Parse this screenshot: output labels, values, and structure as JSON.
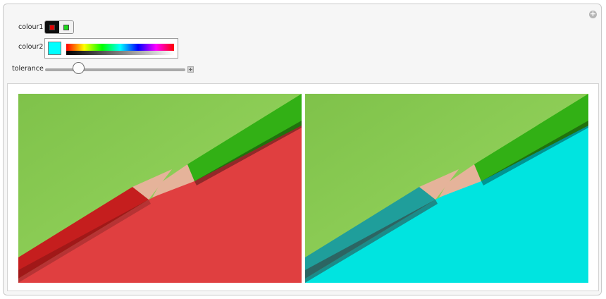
{
  "controls": {
    "colour1": {
      "label": "colour1",
      "options": [
        {
          "name": "red",
          "color": "#e00000",
          "selected": true
        },
        {
          "name": "green",
          "color": "#1ed81e",
          "selected": false
        }
      ]
    },
    "colour2": {
      "label": "colour2",
      "color": "#00ffff"
    },
    "tolerance": {
      "label": "tolerance",
      "value_fraction": 0.24
    }
  },
  "images": {
    "original": {
      "background_top": "#8ccd55",
      "background_bottom": "#e03f40",
      "pencil_left": "#c51e1e",
      "pencil_right": "#32b015",
      "wood": "#e5b39a"
    },
    "recolored": {
      "background_top": "#8ccd55",
      "background_bottom": "#00e4e0",
      "pencil_left": "#1f9e9b",
      "pencil_right": "#32b015",
      "wood": "#e5b39a"
    }
  }
}
